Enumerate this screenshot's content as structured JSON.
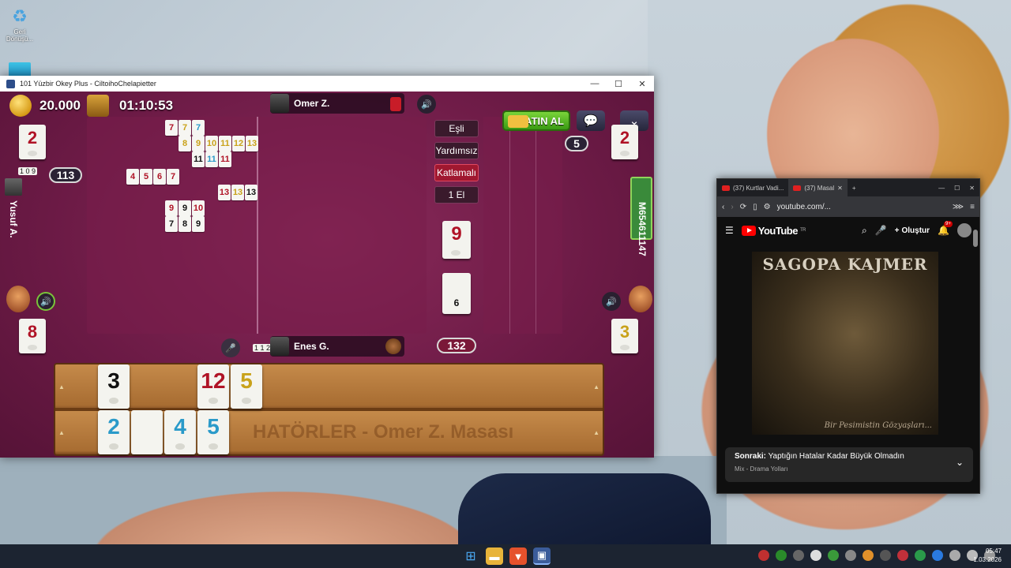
{
  "desktop": {
    "recycle_bin_label": "Geri Dönüşü...",
    "icon2_label": ""
  },
  "game_window": {
    "title": "101 Yüzbir Okey Plus - CiltoihoChelapietter",
    "coins": "20.000",
    "timer": "01:10:53",
    "top_player": "Omer Z.",
    "bottom_player": "Enes G.",
    "left_player": "Yusuf A.",
    "right_player": "M654611147",
    "buy_button": "SATIN AL",
    "options": [
      "Eşli",
      "Yardımsız",
      "Katlamalı",
      "1 El"
    ],
    "active_option": "Katlamalı",
    "left_score": "113",
    "right_badge": "5",
    "bottom_score": "132",
    "corner_tiles": {
      "top_left": "2",
      "top_right": "2",
      "bottom_left": "8",
      "bottom_right": "3"
    },
    "center_tile": "9",
    "deck_count": "6",
    "rack_watermark": "HATÖRLER - Omer Z. Masası",
    "left_indicator_tiles": "1 0 9",
    "bottom_indicator_tiles": "1 1 2",
    "melds": [
      [
        {
          "v": "7",
          "c": "red"
        },
        {
          "v": "7",
          "c": "yellow"
        },
        {
          "v": "7",
          "c": "blue"
        }
      ],
      [
        {
          "v": "8",
          "c": "yellow"
        },
        {
          "v": "9",
          "c": "yellow"
        },
        {
          "v": "10",
          "c": "yellow"
        },
        {
          "v": "11",
          "c": "yellow"
        },
        {
          "v": "12",
          "c": "yellow"
        },
        {
          "v": "13",
          "c": "yellow"
        }
      ],
      [
        {
          "v": "11",
          "c": "black"
        },
        {
          "v": "11",
          "c": "blue"
        },
        {
          "v": "11",
          "c": "red"
        }
      ],
      [
        {
          "v": "4",
          "c": "red"
        },
        {
          "v": "5",
          "c": "red"
        },
        {
          "v": "6",
          "c": "red"
        },
        {
          "v": "7",
          "c": "red"
        }
      ],
      [
        {
          "v": "13",
          "c": "red"
        },
        {
          "v": "13",
          "c": "yellow"
        },
        {
          "v": "13",
          "c": "black"
        }
      ],
      [
        {
          "v": "9",
          "c": "red"
        },
        {
          "v": "9",
          "c": "black"
        },
        {
          "v": "10",
          "c": "red"
        }
      ],
      [
        {
          "v": "7",
          "c": "black"
        },
        {
          "v": "8",
          "c": "black"
        },
        {
          "v": "9",
          "c": "black"
        }
      ]
    ],
    "rack_top": [
      {
        "v": "3",
        "c": "black"
      },
      {
        "v": "12",
        "c": "red"
      },
      {
        "v": "5",
        "c": "yellow"
      }
    ],
    "rack_bottom": [
      {
        "v": "2",
        "c": "blue"
      },
      {
        "v": "",
        "c": "black"
      },
      {
        "v": "4",
        "c": "blue"
      },
      {
        "v": "5",
        "c": "blue"
      }
    ]
  },
  "browser": {
    "tab1": "(37) Kurtlar Vadi...",
    "tab2": "(37) Masal",
    "url": "youtube.com/...",
    "yt_brand": "YouTube",
    "yt_region": "TR",
    "create_label": "Oluştur",
    "notif_count": "9+",
    "video_title": "SAGOPA KAJMER",
    "video_subtitle": "Bir Pesimistin Gözyaşları...",
    "next_prefix": "Sonraki:",
    "next_title": "Yaptığın Hatalar Kadar Büyük Olmadın",
    "next_sub": "Mix - Drama Yolları"
  },
  "taskbar": {
    "time": "05:47",
    "date": "1.03.2026"
  },
  "colors": {
    "felt": "#6b1a45",
    "tile_red": "#b01326",
    "tile_yellow": "#c9a21a",
    "tile_blue": "#2a9ac9",
    "buy_green": "#4fb025"
  }
}
